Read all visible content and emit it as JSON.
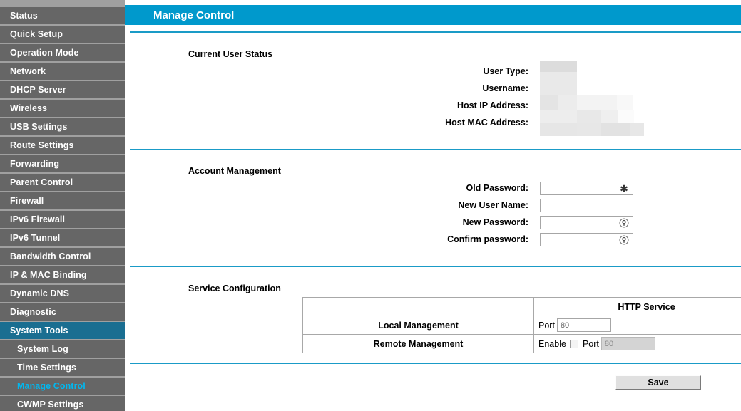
{
  "sidebar": {
    "items": [
      {
        "label": "Status",
        "type": "top",
        "state": "normal"
      },
      {
        "label": "Quick Setup",
        "type": "top",
        "state": "normal"
      },
      {
        "label": "Operation Mode",
        "type": "top",
        "state": "normal"
      },
      {
        "label": "Network",
        "type": "top",
        "state": "normal"
      },
      {
        "label": "DHCP Server",
        "type": "top",
        "state": "normal"
      },
      {
        "label": "Wireless",
        "type": "top",
        "state": "normal"
      },
      {
        "label": "USB Settings",
        "type": "top",
        "state": "normal"
      },
      {
        "label": "Route Settings",
        "type": "top",
        "state": "normal"
      },
      {
        "label": "Forwarding",
        "type": "top",
        "state": "normal"
      },
      {
        "label": "Parent Control",
        "type": "top",
        "state": "normal"
      },
      {
        "label": "Firewall",
        "type": "top",
        "state": "normal"
      },
      {
        "label": "IPv6 Firewall",
        "type": "top",
        "state": "normal"
      },
      {
        "label": "IPv6 Tunnel",
        "type": "top",
        "state": "normal"
      },
      {
        "label": "Bandwidth Control",
        "type": "top",
        "state": "normal"
      },
      {
        "label": "IP & MAC Binding",
        "type": "top",
        "state": "normal"
      },
      {
        "label": "Dynamic DNS",
        "type": "top",
        "state": "normal"
      },
      {
        "label": "Diagnostic",
        "type": "top",
        "state": "normal"
      },
      {
        "label": "System Tools",
        "type": "top",
        "state": "active"
      },
      {
        "label": "System Log",
        "type": "sub",
        "state": "normal"
      },
      {
        "label": "Time Settings",
        "type": "sub",
        "state": "normal"
      },
      {
        "label": "Manage Control",
        "type": "sub",
        "state": "selected"
      },
      {
        "label": "CWMP Settings",
        "type": "sub",
        "state": "normal"
      }
    ]
  },
  "header": {
    "title": "Manage Control"
  },
  "sections": {
    "current_user_status": {
      "title": "Current User Status",
      "fields": [
        {
          "label": "User Type:",
          "value": "",
          "redacted": true
        },
        {
          "label": "Username:",
          "value": "",
          "redacted": true
        },
        {
          "label": "Host IP Address:",
          "value": "",
          "redacted": true
        },
        {
          "label": "Host MAC Address:",
          "value": "",
          "redacted": true
        }
      ]
    },
    "account_management": {
      "title": "Account Management",
      "fields": [
        {
          "label": "Old Password:",
          "value": "",
          "placeholder": "",
          "icon": "asterisk-icon"
        },
        {
          "label": "New User Name:",
          "value": "",
          "placeholder": "",
          "icon": ""
        },
        {
          "label": "New Password:",
          "value": "",
          "placeholder": "",
          "icon": "password-reveal-icon"
        },
        {
          "label": "Confirm password:",
          "value": "",
          "placeholder": "",
          "icon": "password-reveal-icon"
        }
      ]
    },
    "service_configuration": {
      "title": "Service Configuration",
      "table": {
        "headers": [
          "",
          "HTTP Service"
        ],
        "rows": [
          {
            "name": "Local Management",
            "port_label": "Port",
            "port_value": "80",
            "enable_label": "",
            "enable_checked": false,
            "has_enable": false,
            "port_disabled": false
          },
          {
            "name": "Remote Management",
            "port_label": "Port",
            "port_value": "80",
            "enable_label": "Enable",
            "enable_checked": false,
            "has_enable": true,
            "port_disabled": true
          }
        ]
      }
    }
  },
  "actions": {
    "save_label": "Save"
  },
  "colors": {
    "accent": "#0099cc",
    "sidebar_item": "#666666",
    "sidebar_active": "#1a6e91",
    "sidebar_selected_text": "#00b8f0",
    "rule": "#1a9bc7"
  }
}
